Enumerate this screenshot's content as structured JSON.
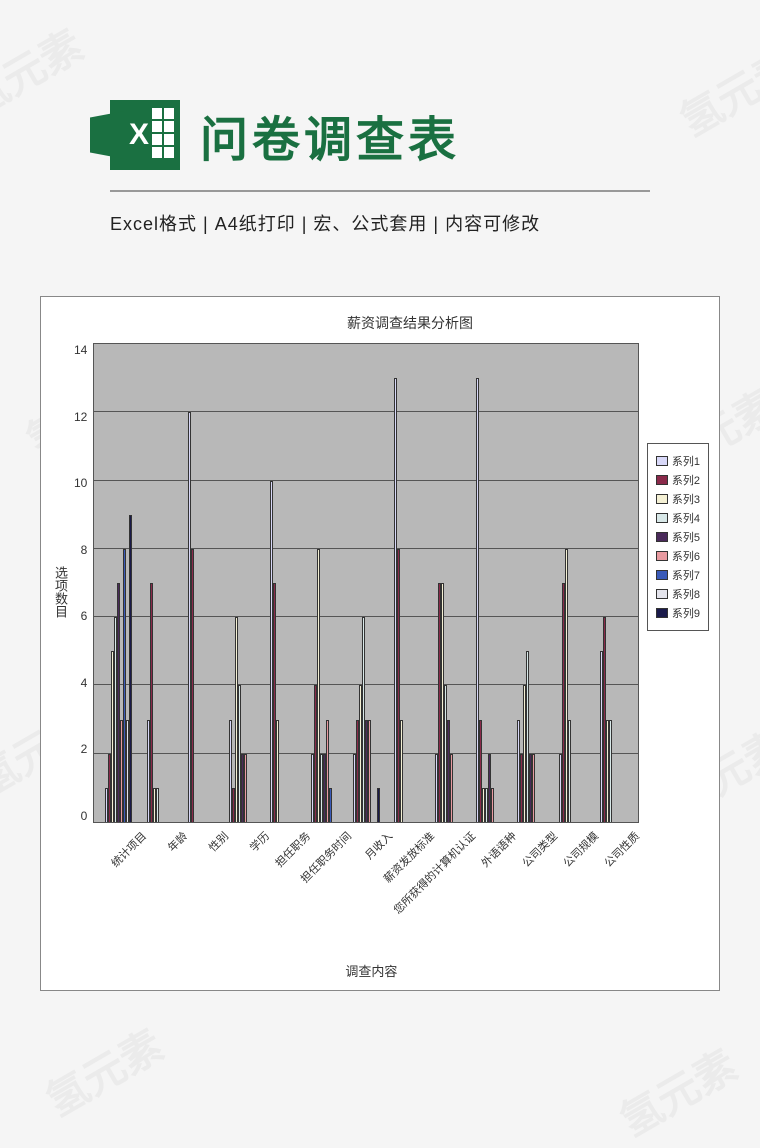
{
  "watermark": "氢元素",
  "header": {
    "icon_letter": "X",
    "title": "问卷调查表",
    "subtitle": "Excel格式 |  A4纸打印 | 宏、公式套用 | 内容可修改"
  },
  "chart_data": {
    "type": "bar",
    "title": "薪资调查结果分析图",
    "ylabel": "选项数目",
    "xlabel": "调查内容",
    "ylim": [
      0,
      14
    ],
    "yticks": [
      0,
      2,
      4,
      6,
      8,
      10,
      12,
      14
    ],
    "categories": [
      "统计项目",
      "年龄",
      "性别",
      "学历",
      "担任职务",
      "担任职务时间",
      "月收入",
      "薪资发放标准",
      "您所获得的计算机认证",
      "外语语种",
      "公司类型",
      "公司规模",
      "公司性质"
    ],
    "series": [
      {
        "name": "系列1",
        "color": "#d8d8f8",
        "values": [
          1,
          3,
          12,
          3,
          10,
          2,
          2,
          13,
          2,
          13,
          3,
          2,
          5
        ]
      },
      {
        "name": "系列2",
        "color": "#8a2a4a",
        "values": [
          2,
          7,
          8,
          1,
          7,
          4,
          3,
          8,
          7,
          3,
          2,
          7,
          6
        ]
      },
      {
        "name": "系列3",
        "color": "#f4f0d4",
        "values": [
          5,
          1,
          0,
          6,
          3,
          8,
          4,
          3,
          7,
          1,
          4,
          8,
          3
        ]
      },
      {
        "name": "系列4",
        "color": "#d8e8e8",
        "values": [
          6,
          1,
          0,
          4,
          0,
          2,
          6,
          0,
          4,
          1,
          5,
          3,
          3
        ]
      },
      {
        "name": "系列5",
        "color": "#4a2a5a",
        "values": [
          7,
          0,
          0,
          2,
          0,
          2,
          3,
          0,
          3,
          2,
          2,
          0,
          0
        ]
      },
      {
        "name": "系列6",
        "color": "#e89aa0",
        "values": [
          3,
          0,
          0,
          2,
          0,
          3,
          3,
          0,
          2,
          1,
          2,
          0,
          0
        ]
      },
      {
        "name": "系列7",
        "color": "#3a5ab8",
        "values": [
          8,
          0,
          0,
          0,
          0,
          1,
          0,
          0,
          0,
          0,
          0,
          0,
          0
        ]
      },
      {
        "name": "系列8",
        "color": "#e4e4ec",
        "values": [
          3,
          0,
          0,
          0,
          0,
          0,
          0,
          0,
          0,
          0,
          0,
          0,
          0
        ]
      },
      {
        "name": "系列9",
        "color": "#1a1a4a",
        "values": [
          9,
          0,
          0,
          0,
          0,
          0,
          1,
          0,
          0,
          0,
          0,
          0,
          0
        ]
      }
    ]
  }
}
